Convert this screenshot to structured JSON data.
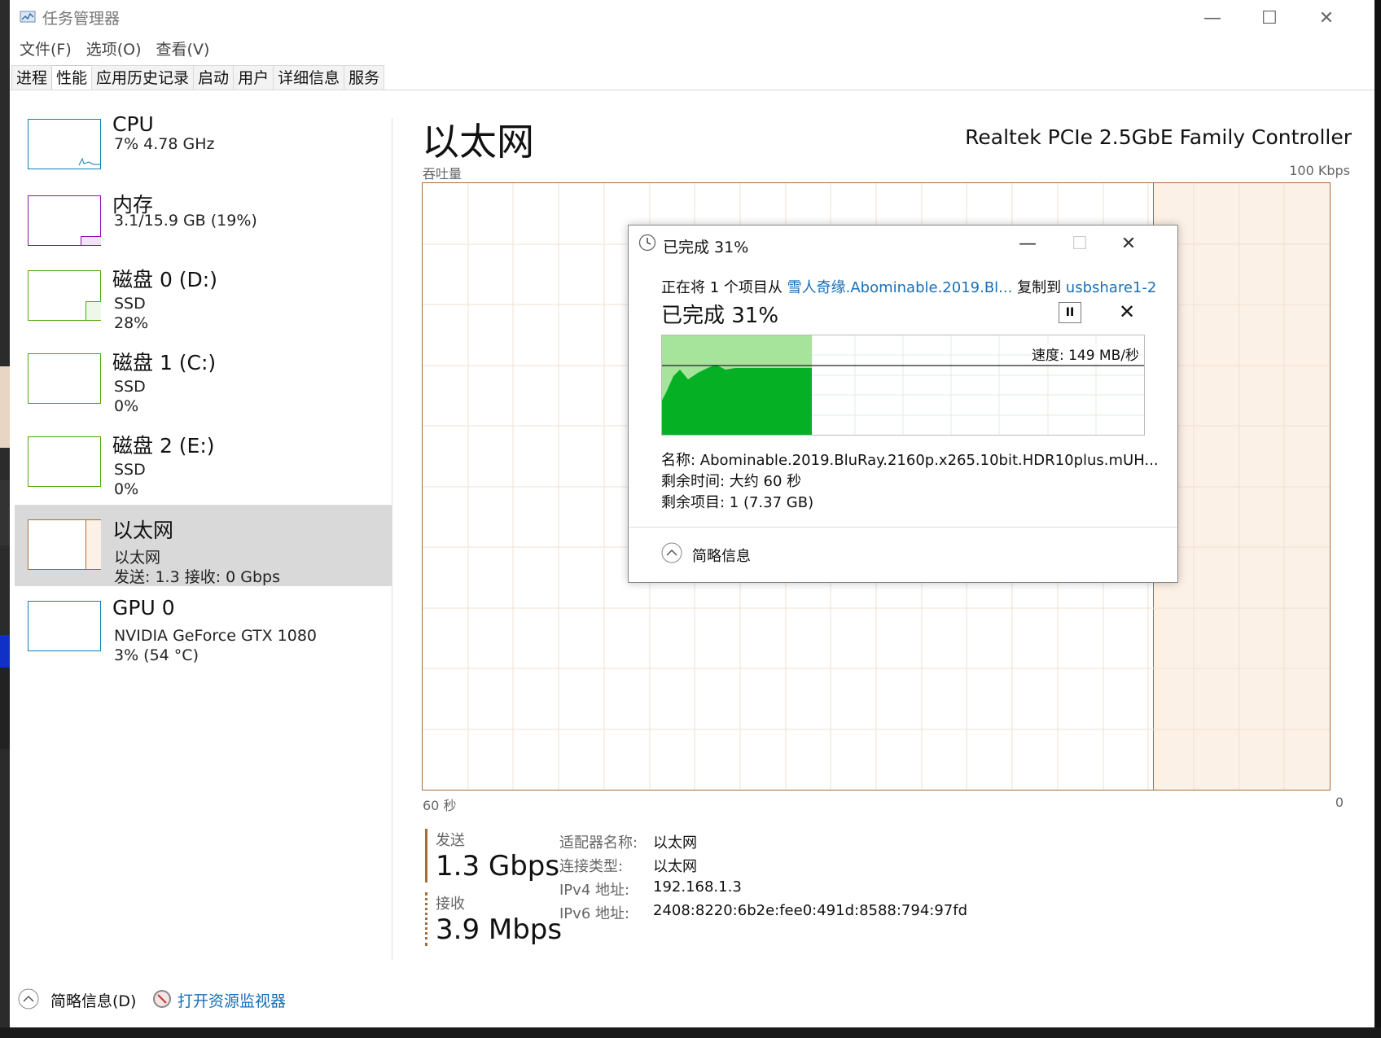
{
  "window": {
    "title": "任务管理器",
    "minimize": "—",
    "maximize": "☐",
    "close": "✕"
  },
  "menu": [
    "文件(F)",
    "选项(O)",
    "查看(V)"
  ],
  "tabs": [
    "进程",
    "性能",
    "应用历史记录",
    "启动",
    "用户",
    "详细信息",
    "服务"
  ],
  "active_tab": "性能",
  "sidebar": {
    "items": [
      {
        "name": "CPU",
        "line1": "7%  4.78 GHz",
        "line2": "",
        "color": "#117dbb"
      },
      {
        "name": "内存",
        "line1": "3.1/15.9 GB (19%)",
        "line2": "",
        "color": "#8b12ae"
      },
      {
        "name": "磁盘 0 (D:)",
        "line1": "SSD",
        "line2": "28%",
        "color": "#4da60c"
      },
      {
        "name": "磁盘 1 (C:)",
        "line1": "SSD",
        "line2": "0%",
        "color": "#4da60c"
      },
      {
        "name": "磁盘 2 (E:)",
        "line1": "SSD",
        "line2": "0%",
        "color": "#4da60c"
      },
      {
        "name": "以太网",
        "line1": "以太网",
        "line2": "发送: 1.3  接收: 0 Gbps",
        "color": "#a56d3c"
      },
      {
        "name": "GPU 0",
        "line1": "NVIDIA GeForce GTX 1080",
        "line2": "3%  (54 °C)",
        "color": "#117dbb"
      }
    ],
    "selected_index": 5
  },
  "main": {
    "title": "以太网",
    "adapter": "Realtek PCIe 2.5GbE Family Controller",
    "graph_label": "吞吐量",
    "graph_max": "100 Kbps",
    "axis_left": "60 秒",
    "axis_right": "0",
    "send_label": "发送",
    "send_value": "1.3 Gbps",
    "recv_label": "接收",
    "recv_value": "3.9 Mbps",
    "properties": [
      {
        "key": "适配器名称:",
        "value": "以太网"
      },
      {
        "key": "连接类型:",
        "value": "以太网"
      },
      {
        "key": "IPv4 地址:",
        "value": "192.168.1.3"
      },
      {
        "key": "IPv6 地址:",
        "value": "2408:8220:6b2e:fee0:491d:8588:794:97fd"
      }
    ],
    "accent_color": "#a56d3c"
  },
  "footer": {
    "summary": "简略信息(D)",
    "resmon": "打开资源监视器"
  },
  "copy_dialog": {
    "title": "已完成 31%",
    "line_prefix": "正在将 1 个项目从 ",
    "source": "雪人奇缘.Abominable.2019.Bl...",
    "line_mid": " 复制到 ",
    "dest": "usbshare1-2",
    "percent_text": "已完成 31%",
    "progress": 0.31,
    "speed": "速度: 149 MB/秒",
    "name": "名称:  Abominable.2019.BluRay.2160p.x265.10bit.HDR10plus.mUH...",
    "time_left": "剩余时间:  大约 60 秒",
    "items_left": "剩余项目:  1 (7.37 GB)",
    "less_info": "简略信息",
    "pause_icon": "II",
    "cancel_icon": "✕"
  }
}
